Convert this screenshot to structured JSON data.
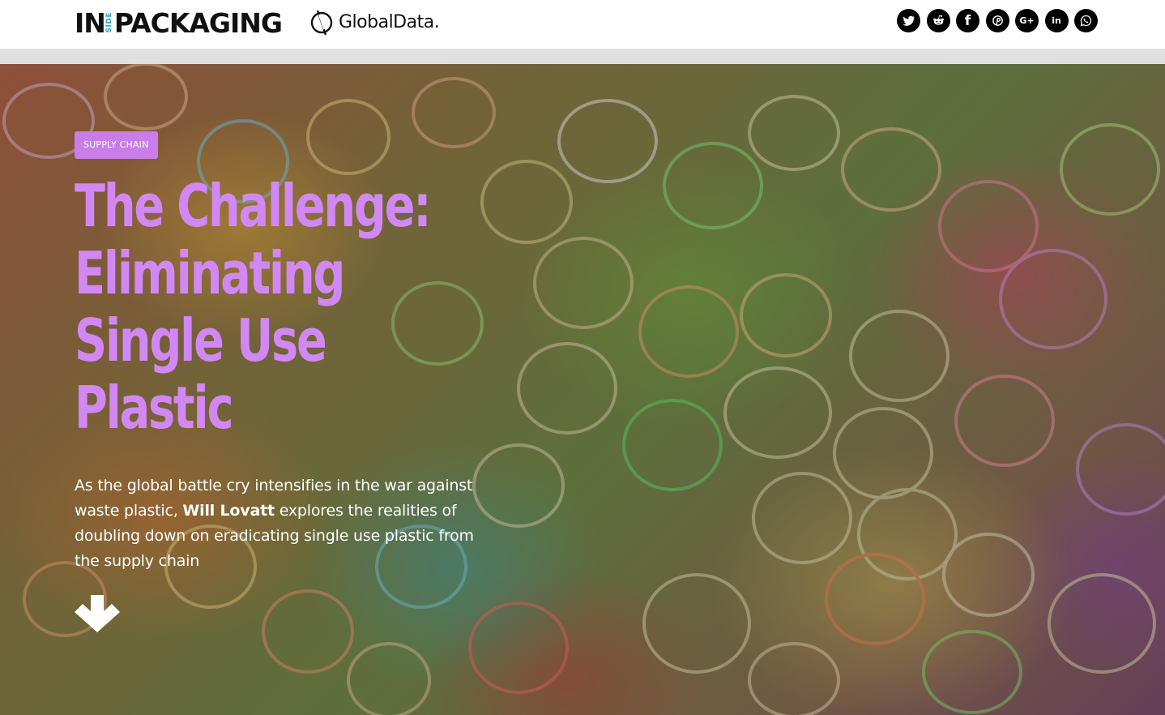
{
  "header": {
    "logo_in": "IN",
    "logo_side": "SIDE",
    "logo_packaging": "PACKAGING",
    "partner_logo": "GlobalData.",
    "social": [
      {
        "name": "twitter",
        "icon": "twitter-icon"
      },
      {
        "name": "reddit",
        "icon": "reddit-icon"
      },
      {
        "name": "facebook",
        "icon": "facebook-icon",
        "glyph": "f"
      },
      {
        "name": "pinterest",
        "icon": "pinterest-icon",
        "glyph": "P"
      },
      {
        "name": "google-plus",
        "icon": "google-plus-icon",
        "glyph": "G+"
      },
      {
        "name": "linkedin",
        "icon": "linkedin-icon",
        "glyph": "in"
      },
      {
        "name": "whatsapp",
        "icon": "whatsapp-icon"
      }
    ]
  },
  "hero": {
    "category": "SUPPLY CHAIN",
    "title_lines": [
      "The Challenge:",
      "Eliminating",
      "Single Use",
      "Plastic"
    ],
    "dek_before": "As the global battle cry intensifies in the war against waste plastic, ",
    "dek_author": "Will Lovatt",
    "dek_after": " explores the realities of doubling down on eradicating single use plastic from the supply chain",
    "scroll_icon": "arrow-down-icon"
  },
  "colors": {
    "accent": "#c97de8",
    "headline": "#d188f5",
    "logo_side": "#2aa6c7"
  }
}
